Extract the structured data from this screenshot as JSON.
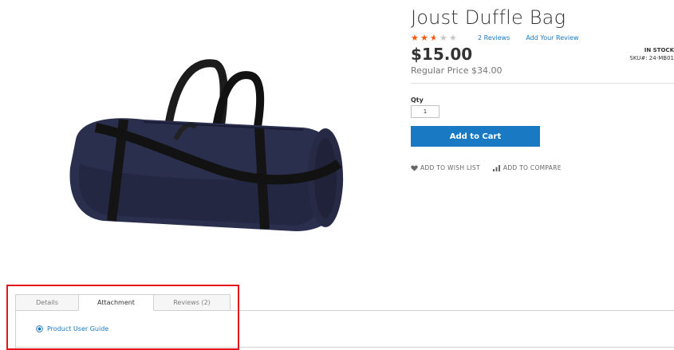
{
  "product": {
    "title": "Joust Duffle Bag",
    "rating_percent": 50,
    "reviews_link": "2  Reviews",
    "add_review_link": "Add Your Review",
    "price": "$15.00",
    "regular_price": "Regular Price $34.00",
    "stock_status": "IN STOCK",
    "sku": "SKU#:  24-MB01",
    "qty_label": "Qty",
    "qty_value": "1",
    "add_to_cart": "Add to Cart",
    "wish_list": "ADD TO WISH LIST",
    "compare": "ADD TO COMPARE",
    "image_icon": "duffle-bag-photo"
  },
  "tabs": {
    "items": [
      {
        "label": "Details"
      },
      {
        "label": "Attachment"
      },
      {
        "label": "Reviews (2)"
      }
    ],
    "active_index": 1,
    "attachment_link": "Product User Guide"
  },
  "colors": {
    "accent": "#1979c3",
    "star": "#ff5501",
    "highlight": "#e3161c",
    "bag": "#2b2f4e"
  }
}
